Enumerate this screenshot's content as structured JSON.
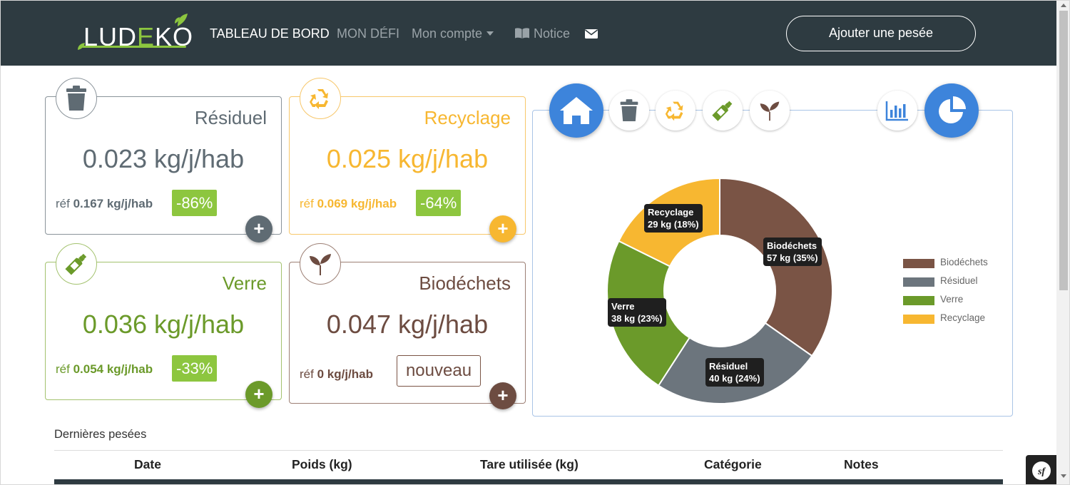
{
  "navbar": {
    "logo": {
      "part1": "LUD",
      "part2": "E",
      "part3": "KO"
    },
    "links": {
      "dashboard": "TABLEAU DE BORD",
      "challenge": "MON DÉFI",
      "account": "Mon compte",
      "notice": "Notice"
    },
    "add_button": "Ajouter une pesée",
    "colors": {
      "background": "#2e3b41",
      "accent": "#8cc63f"
    }
  },
  "cards": {
    "residuel": {
      "title": "Résiduel",
      "value": "0.023 kg/j/hab",
      "ref_label": "réf",
      "ref_value": "0.167 kg/j/hab",
      "badge": "-86%",
      "color": "#5f6b73",
      "icon": "trash-icon"
    },
    "recyclage": {
      "title": "Recyclage",
      "value": "0.025 kg/j/hab",
      "ref_label": "réf",
      "ref_value": "0.069 kg/j/hab",
      "badge": "-64%",
      "color": "#f7b731",
      "icon": "recycle-icon"
    },
    "verre": {
      "title": "Verre",
      "value": "0.036 kg/j/hab",
      "ref_label": "réf",
      "ref_value": "0.054 kg/j/hab",
      "badge": "-33%",
      "color": "#6b9a2a",
      "icon": "bottle-icon"
    },
    "biodechets": {
      "title": "Biodéchets",
      "value": "0.047 kg/j/hab",
      "ref_label": "réf",
      "ref_value": "0 kg/j/hab",
      "badge": "nouveau",
      "color": "#6d4c41",
      "icon": "sprout-icon"
    }
  },
  "plus_label": "+",
  "chart_data": {
    "type": "pie",
    "variant": "donut",
    "categories": [
      "Biodéchets",
      "Résiduel",
      "Verre",
      "Recyclage"
    ],
    "values": [
      57,
      40,
      38,
      29
    ],
    "percentages": [
      35,
      24,
      23,
      18
    ],
    "unit": "kg",
    "data_labels": [
      "57 kg (35%)",
      "40 kg (24%)",
      "38 kg (23%)",
      "29 kg (18%)"
    ],
    "colors": [
      "#7a5445",
      "#6c757d",
      "#6b9a2a",
      "#f7b731"
    ],
    "legend_position": "right"
  },
  "table": {
    "section_title": "Dernières pesées",
    "columns": [
      "Date",
      "Poids (kg)",
      "Tare utilisée (kg)",
      "Catégorie",
      "Notes"
    ]
  }
}
